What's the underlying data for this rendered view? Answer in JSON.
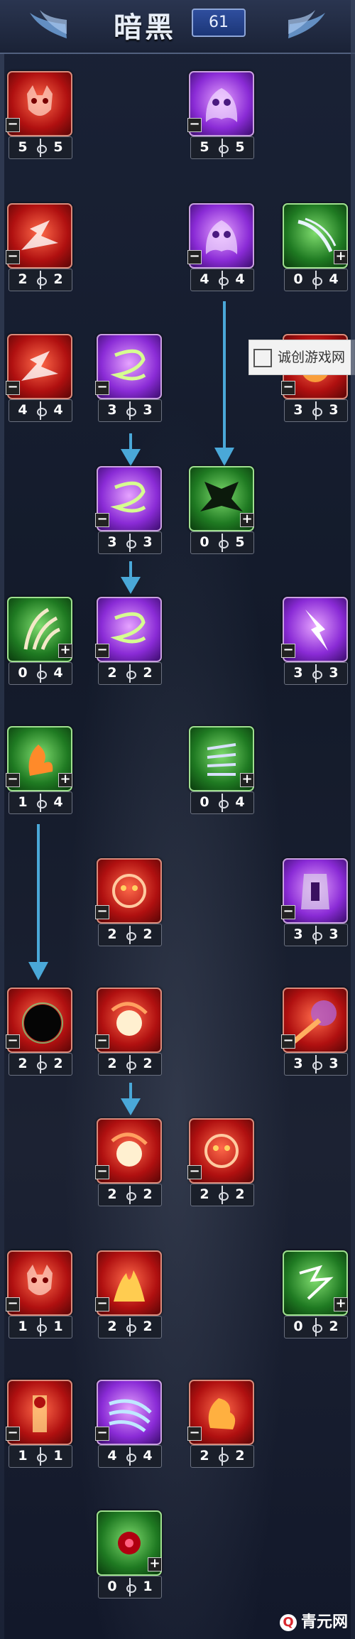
{
  "header": {
    "title": "暗黑",
    "points": "61"
  },
  "skills": [
    {
      "icon": "demon-face-icon",
      "cur": "5",
      "max": "5",
      "color": "red",
      "minus": true,
      "plus": false
    },
    {
      "icon": "skull-spirit-icon",
      "cur": "5",
      "max": "5",
      "color": "purple",
      "minus": true,
      "plus": false
    },
    {
      "icon": "shadow-burst-icon",
      "cur": "2",
      "max": "2",
      "color": "red",
      "minus": true,
      "plus": false
    },
    {
      "icon": "skull-spirit-icon",
      "cur": "4",
      "max": "4",
      "color": "purple",
      "minus": true,
      "plus": false
    },
    {
      "icon": "claw-slash-icon",
      "cur": "0",
      "max": "4",
      "color": "green",
      "minus": false,
      "plus": true
    },
    {
      "icon": "shadow-burst-icon",
      "cur": "4",
      "max": "4",
      "color": "red",
      "minus": true,
      "plus": false
    },
    {
      "icon": "void-swirl-icon",
      "cur": "3",
      "max": "3",
      "color": "purple",
      "minus": true,
      "plus": false
    },
    {
      "icon": "fire-blast-icon",
      "cur": "3",
      "max": "3",
      "color": "red",
      "minus": true,
      "plus": false
    },
    {
      "icon": "void-swirl-icon",
      "cur": "3",
      "max": "3",
      "color": "purple",
      "minus": true,
      "plus": false
    },
    {
      "icon": "dark-wings-icon",
      "cur": "0",
      "max": "5",
      "color": "green",
      "minus": false,
      "plus": true
    },
    {
      "icon": "leaf-claw-icon",
      "cur": "0",
      "max": "4",
      "color": "green",
      "minus": false,
      "plus": true
    },
    {
      "icon": "void-swirl-icon",
      "cur": "2",
      "max": "2",
      "color": "purple",
      "minus": true,
      "plus": false
    },
    {
      "icon": "lightning-strike-icon",
      "cur": "3",
      "max": "3",
      "color": "purple",
      "minus": true,
      "plus": false
    },
    {
      "icon": "fire-hand-icon",
      "cur": "1",
      "max": "4",
      "color": "green",
      "minus": true,
      "plus": true
    },
    {
      "icon": "spike-wall-icon",
      "cur": "0",
      "max": "4",
      "color": "green",
      "minus": false,
      "plus": true
    },
    {
      "icon": "fire-demon-icon",
      "cur": "2",
      "max": "2",
      "color": "red",
      "minus": true,
      "plus": false
    },
    {
      "icon": "armored-knight-icon",
      "cur": "3",
      "max": "3",
      "color": "purple",
      "minus": true,
      "plus": false
    },
    {
      "icon": "dark-orb-icon",
      "cur": "2",
      "max": "2",
      "color": "red",
      "minus": true,
      "plus": false
    },
    {
      "icon": "flame-orb-icon",
      "cur": "2",
      "max": "2",
      "color": "red",
      "minus": true,
      "plus": false
    },
    {
      "icon": "meteor-strike-icon",
      "cur": "3",
      "max": "3",
      "color": "red",
      "minus": true,
      "plus": false
    },
    {
      "icon": "flame-orb-icon",
      "cur": "2",
      "max": "2",
      "color": "red",
      "minus": true,
      "plus": false
    },
    {
      "icon": "fire-demon-icon",
      "cur": "2",
      "max": "2",
      "color": "red",
      "minus": true,
      "plus": false
    },
    {
      "icon": "demon-face-icon",
      "cur": "1",
      "max": "1",
      "color": "red",
      "minus": true,
      "plus": false
    },
    {
      "icon": "flame-hands-icon",
      "cur": "2",
      "max": "2",
      "color": "red",
      "minus": true,
      "plus": false
    },
    {
      "icon": "lightning-claw-icon",
      "cur": "0",
      "max": "2",
      "color": "green",
      "minus": false,
      "plus": true
    },
    {
      "icon": "fire-totem-icon",
      "cur": "1",
      "max": "1",
      "color": "red",
      "minus": true,
      "plus": false
    },
    {
      "icon": "wind-dash-icon",
      "cur": "4",
      "max": "4",
      "color": "purple",
      "minus": true,
      "plus": false
    },
    {
      "icon": "fire-beast-icon",
      "cur": "2",
      "max": "2",
      "color": "red",
      "minus": true,
      "plus": false
    },
    {
      "icon": "blood-flower-icon",
      "cur": "0",
      "max": "1",
      "color": "green",
      "minus": false,
      "plus": true
    }
  ],
  "watermark": "诚创游戏网",
  "footer_logo": "青元网",
  "footer_logo_mark": "Q"
}
